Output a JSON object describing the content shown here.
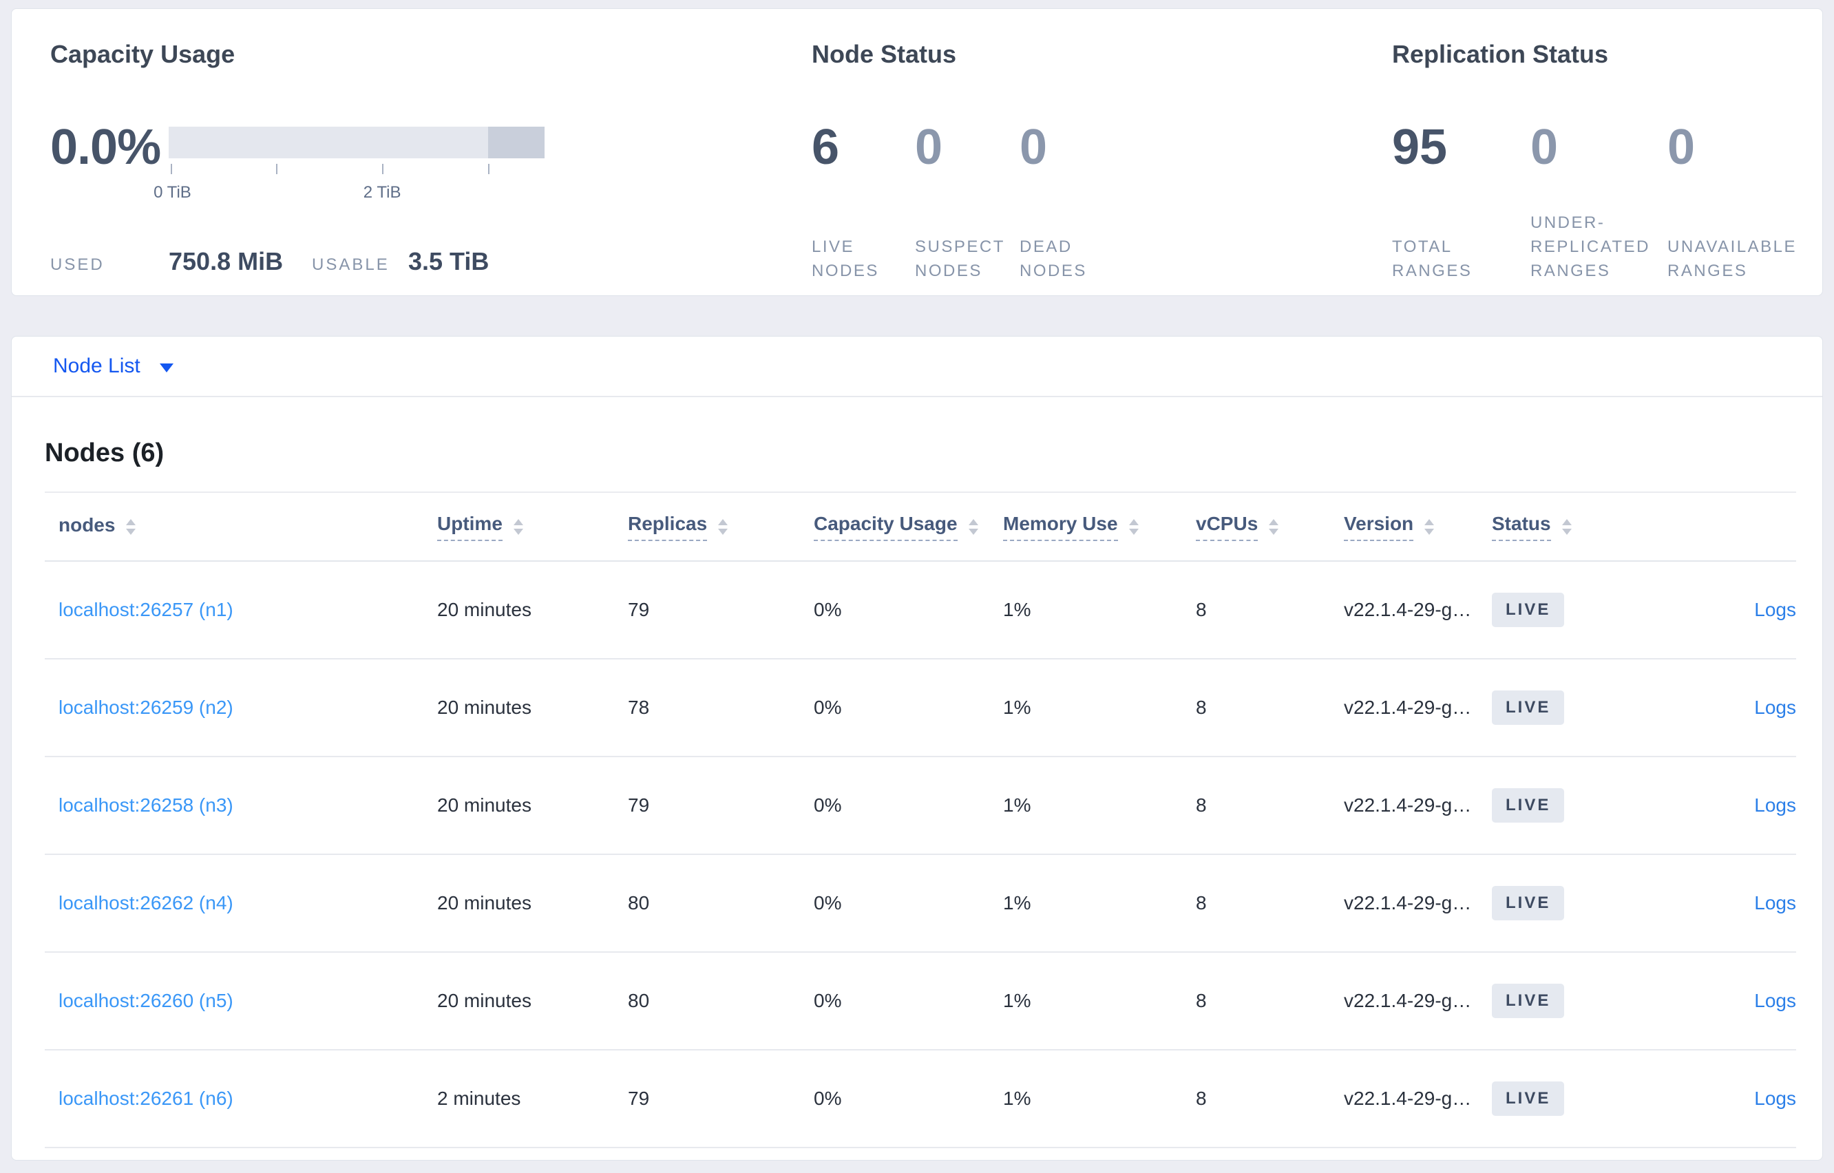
{
  "capacity_usage": {
    "title": "Capacity Usage",
    "percent_used": "0.0%",
    "tick_labels": [
      "0 TiB",
      "2 TiB"
    ],
    "used_label": "USED",
    "used_value": "750.8 MiB",
    "usable_label": "USABLE",
    "usable_value": "3.5 TiB"
  },
  "node_status": {
    "title": "Node Status",
    "metrics": [
      {
        "value": "6",
        "label": "LIVE NODES"
      },
      {
        "value": "0",
        "label": "SUSPECT NODES"
      },
      {
        "value": "0",
        "label": "DEAD NODES"
      }
    ]
  },
  "replication_status": {
    "title": "Replication Status",
    "metrics": [
      {
        "value": "95",
        "label": "TOTAL RANGES"
      },
      {
        "value": "0",
        "label": "UNDER-REPLICATED RANGES"
      },
      {
        "value": "0",
        "label": "UNAVAILABLE RANGES"
      }
    ]
  },
  "node_list": {
    "selector_label": "Node List",
    "heading": "Nodes (6)",
    "columns": [
      "nodes",
      "Uptime",
      "Replicas",
      "Capacity Usage",
      "Memory Use",
      "vCPUs",
      "Version",
      "Status"
    ],
    "rows": [
      {
        "address": "localhost:26257 (n1)",
        "uptime": "20 minutes",
        "replicas": "79",
        "capacity_usage": "0%",
        "memory_use": "1%",
        "vcpus": "8",
        "version": "v22.1.4-29-g…",
        "status": "LIVE",
        "logs_label": "Logs"
      },
      {
        "address": "localhost:26259 (n2)",
        "uptime": "20 minutes",
        "replicas": "78",
        "capacity_usage": "0%",
        "memory_use": "1%",
        "vcpus": "8",
        "version": "v22.1.4-29-g…",
        "status": "LIVE",
        "logs_label": "Logs"
      },
      {
        "address": "localhost:26258 (n3)",
        "uptime": "20 minutes",
        "replicas": "79",
        "capacity_usage": "0%",
        "memory_use": "1%",
        "vcpus": "8",
        "version": "v22.1.4-29-g…",
        "status": "LIVE",
        "logs_label": "Logs"
      },
      {
        "address": "localhost:26262 (n4)",
        "uptime": "20 minutes",
        "replicas": "80",
        "capacity_usage": "0%",
        "memory_use": "1%",
        "vcpus": "8",
        "version": "v22.1.4-29-g…",
        "status": "LIVE",
        "logs_label": "Logs"
      },
      {
        "address": "localhost:26260 (n5)",
        "uptime": "20 minutes",
        "replicas": "80",
        "capacity_usage": "0%",
        "memory_use": "1%",
        "vcpus": "8",
        "version": "v22.1.4-29-g…",
        "status": "LIVE",
        "logs_label": "Logs"
      },
      {
        "address": "localhost:26261 (n6)",
        "uptime": "2 minutes",
        "replicas": "79",
        "capacity_usage": "0%",
        "memory_use": "1%",
        "vcpus": "8",
        "version": "v22.1.4-29-g…",
        "status": "LIVE",
        "logs_label": "Logs"
      }
    ]
  },
  "colors": {
    "page_background": "#ecedf3",
    "dropdown_link_blue": "#1457f0",
    "node_link_blue": "#3a97f7",
    "logs_link_blue": "#2b7fe8",
    "badge_background": "#e5e9f0",
    "badge_text": "#3d4a61",
    "bar_track": "#e4e7ee",
    "bar_remainder": "#c9cfdb",
    "primary_number": "#475469",
    "muted_number": "#8b97ac"
  }
}
